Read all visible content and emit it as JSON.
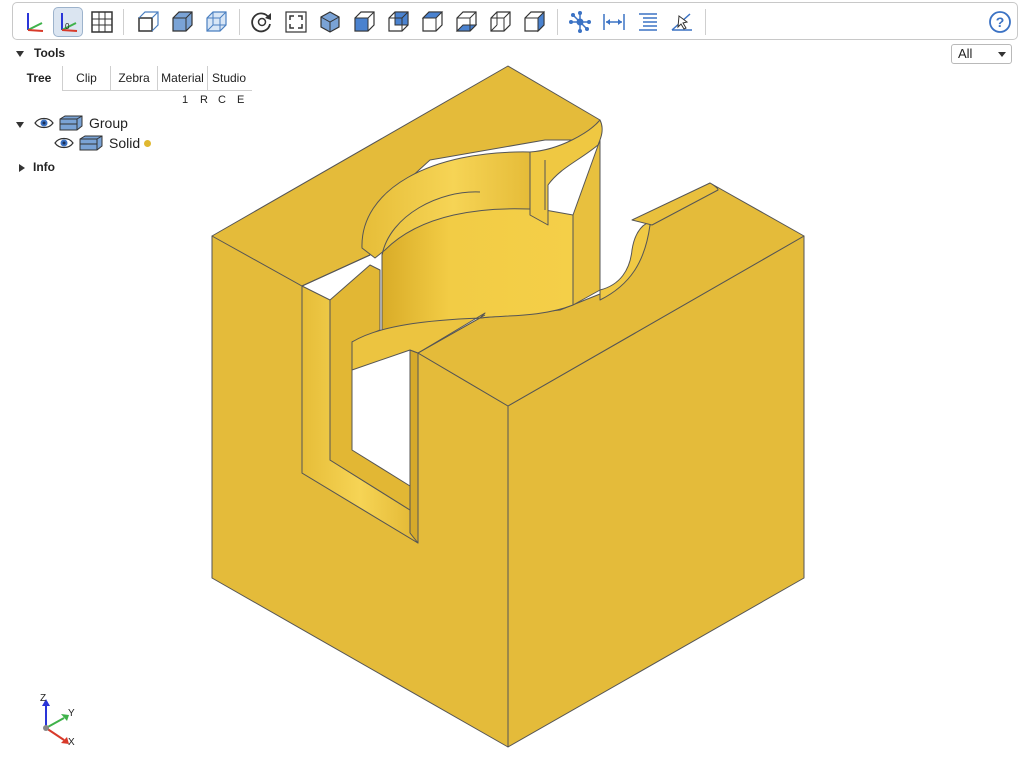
{
  "toolbar": {
    "buttons": [
      {
        "icon": "axes-icon",
        "active": false
      },
      {
        "icon": "axes-origin-icon",
        "active": true
      },
      {
        "icon": "grid-icon",
        "active": false
      },
      {
        "icon": "perspective-icon",
        "active": false
      },
      {
        "icon": "solid-view-icon",
        "active": false
      },
      {
        "icon": "transparent-view-icon",
        "active": false
      },
      {
        "icon": "reset-view-icon",
        "active": false
      },
      {
        "icon": "fit-view-icon",
        "active": false
      },
      {
        "icon": "iso-view-icon",
        "active": false
      },
      {
        "icon": "front-view-icon",
        "active": false
      },
      {
        "icon": "rear-view-icon",
        "active": false
      },
      {
        "icon": "top-view-icon",
        "active": false
      },
      {
        "icon": "bottom-view-icon",
        "active": false
      },
      {
        "icon": "left-view-icon",
        "active": false
      },
      {
        "icon": "right-view-icon",
        "active": false
      },
      {
        "icon": "explode-icon",
        "active": false
      },
      {
        "icon": "measure-distance-icon",
        "active": false
      },
      {
        "icon": "properties-list-icon",
        "active": false
      },
      {
        "icon": "select-angle-icon",
        "active": false
      }
    ],
    "help_icon": "help-icon"
  },
  "view_select": {
    "value": "All"
  },
  "panel": {
    "tools_label": "Tools",
    "tabs": [
      "Tree",
      "Clip",
      "Zebra",
      "Material",
      "Studio"
    ],
    "selected_tab": "Tree",
    "column_flags": [
      "1",
      "R",
      "C",
      "E"
    ],
    "tree": {
      "group_label": "Group",
      "solid_label": "Solid",
      "solid_color": "#e0b830"
    },
    "info_label": "Info"
  },
  "model": {
    "face_color": "#e4bb3a",
    "edge_color": "#555555"
  },
  "axes_indicator": {
    "z": "Z",
    "y": "Y",
    "x": "X"
  }
}
